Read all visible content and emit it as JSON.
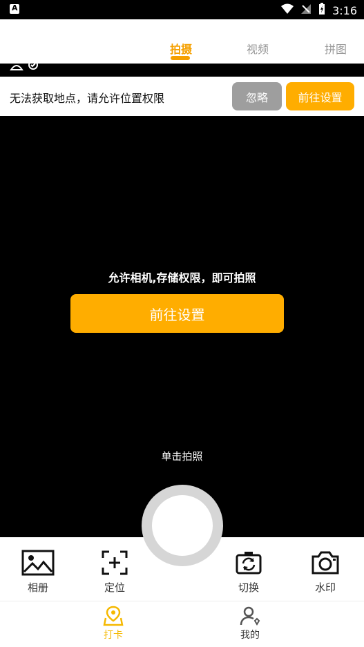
{
  "status_bar": {
    "time": "3:16"
  },
  "top_tabs": [
    {
      "label": "拍摄",
      "active": true
    },
    {
      "label": "视频",
      "active": false
    },
    {
      "label": "拼图",
      "active": false
    }
  ],
  "location_banner": {
    "message": "无法获取地点，请允许位置权限",
    "ignore_label": "忽略",
    "settings_label": "前往设置"
  },
  "camera_permission": {
    "message": "允许相机,存储权限，即可拍照",
    "settings_label": "前往设置"
  },
  "shutter_hint": "单击拍照",
  "tools": [
    {
      "label": "相册",
      "icon": "image-icon"
    },
    {
      "label": "定位",
      "icon": "locate-icon"
    },
    {
      "label": "切换",
      "icon": "switch-camera-icon"
    },
    {
      "label": "水印",
      "icon": "camera-icon"
    }
  ],
  "bottom_nav": [
    {
      "label": "打卡",
      "icon": "map-pin-icon",
      "active": true
    },
    {
      "label": "我的",
      "icon": "user-icon",
      "active": false
    }
  ],
  "colors": {
    "accent": "#ffad00",
    "gray_button": "#9e9e9e",
    "camera_bg": "#000000"
  }
}
